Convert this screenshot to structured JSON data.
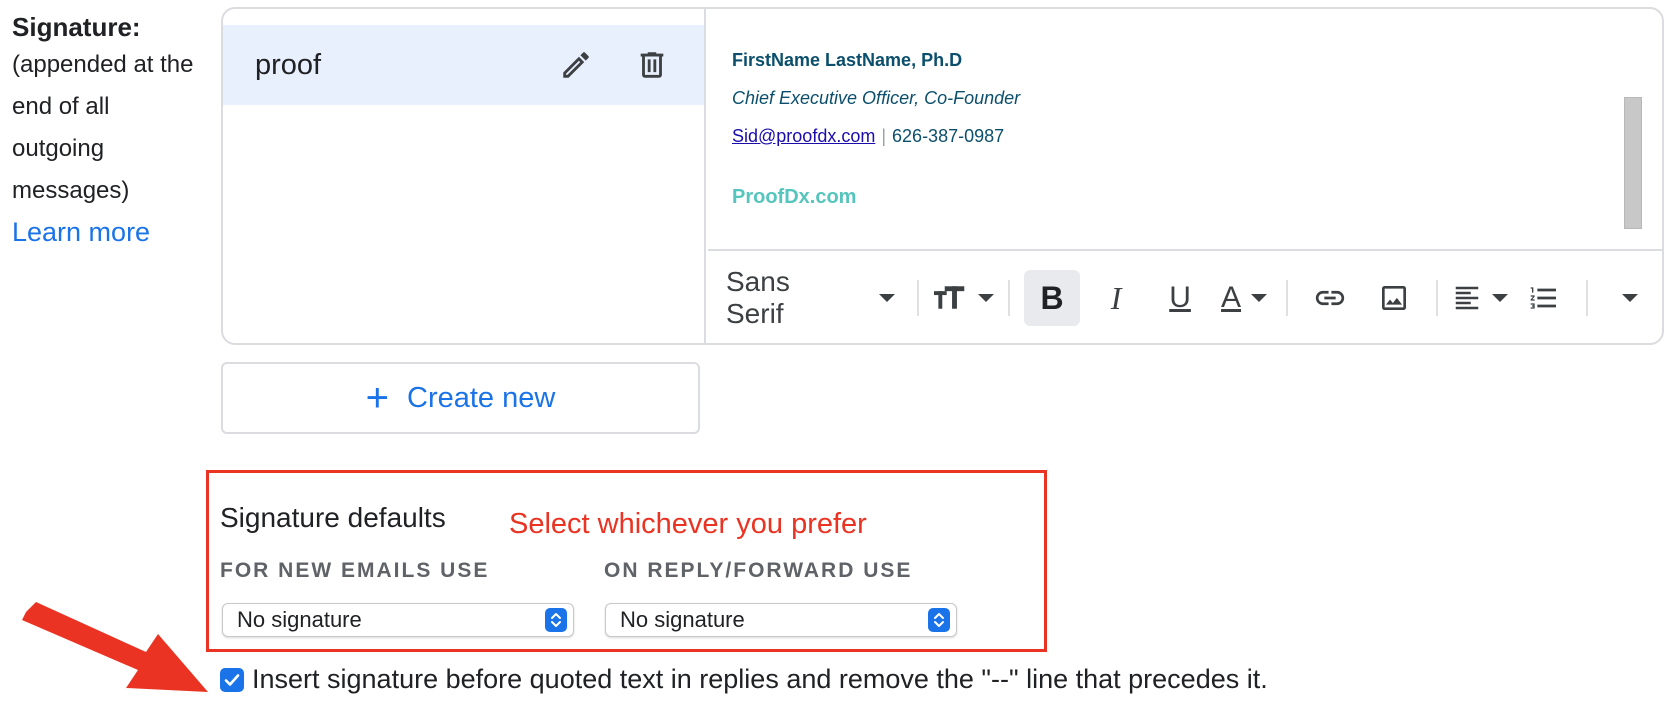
{
  "label_column": {
    "title": "Signature:",
    "description_lines": [
      "(appended at the",
      "end of all",
      "outgoing",
      "messages)"
    ],
    "learn_more": "Learn more"
  },
  "signature_list": {
    "items": [
      {
        "name": "proof"
      }
    ]
  },
  "signature_content": {
    "name_line": "FirstName LastName, Ph.D",
    "role_line": "Chief Executive Officer, Co-Founder",
    "email": "Sid@proofdx.com",
    "separator": "|",
    "phone": "626-387-0987",
    "brand": "ProofDx.com"
  },
  "toolbar": {
    "font_family": "Sans Serif",
    "bold_label": "B",
    "italic_label": "I",
    "underline_label": "U",
    "text_color_label": "A",
    "active": "bold"
  },
  "create_new": {
    "plus": "+",
    "label": "Create new"
  },
  "defaults": {
    "title": "Signature defaults",
    "annotation": "Select whichever you prefer",
    "new_emails_label": "FOR NEW EMAILS USE",
    "new_emails_value": "No signature",
    "reply_label": "ON REPLY/FORWARD USE",
    "reply_value": "No signature"
  },
  "insert_option": {
    "checked": true,
    "label": "Insert signature before quoted text in replies and remove the \"--\" line that precedes it."
  },
  "colors": {
    "accent": "#1a73e8",
    "annotation_red": "#ea3323",
    "selected_row": "#e8f0fe",
    "brand_teal": "#55c5bd"
  }
}
